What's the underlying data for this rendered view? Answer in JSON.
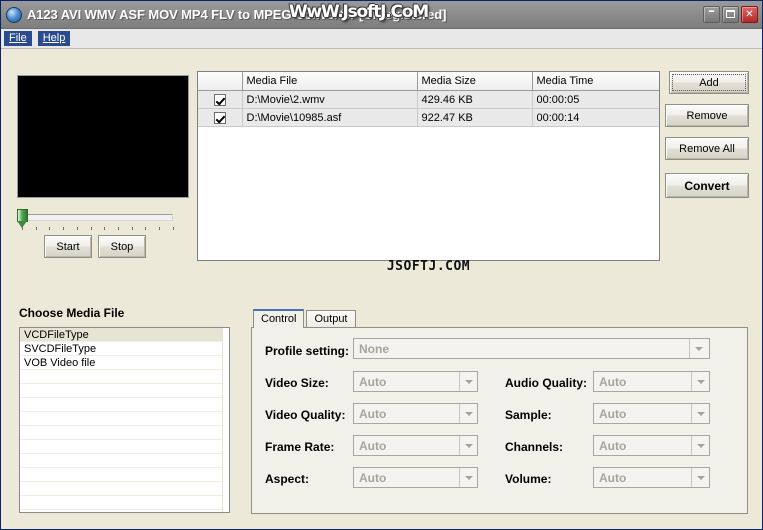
{
  "window": {
    "title": "A123 AVI WMV ASF MOV MP4 FLV to MPEG Converter [Unregistered]",
    "watermark": "WwW.JsoftJ.CoM",
    "minimize_label": "–",
    "maximize_label": "",
    "close_label": "✕"
  },
  "menu": {
    "items": [
      {
        "label": "File"
      },
      {
        "label": "Help"
      }
    ]
  },
  "preview": {
    "slider_value": "0",
    "start_label": "Start",
    "stop_label": "Stop"
  },
  "filelist": {
    "columns": [
      "",
      "Media File",
      "Media Size",
      "Media Time"
    ],
    "rows": [
      {
        "checked": true,
        "file": "D:\\Movie\\2.wmv",
        "size": "429.46 KB",
        "time": "00:00:05"
      },
      {
        "checked": true,
        "file": "D:\\Movie\\10985.asf",
        "size": "922.47 KB",
        "time": "00:00:14"
      }
    ],
    "watermark": "JSOFTJ.COM"
  },
  "actions": {
    "add_label": "Add",
    "remove_label": "Remove",
    "remove_all_label": "Remove All",
    "convert_label": "Convert"
  },
  "media_types": {
    "title": "Choose Media File",
    "items": [
      {
        "label": "VCDFileType",
        "selected": true
      },
      {
        "label": "SVCDFileType",
        "selected": false
      },
      {
        "label": "VOB Video file",
        "selected": false
      }
    ]
  },
  "tabs": [
    {
      "label": "Control",
      "active": true
    },
    {
      "label": "Output",
      "active": false
    }
  ],
  "control_panel": {
    "profile": {
      "label": "Profile setting:",
      "value": "None"
    },
    "left_fields": [
      {
        "label": "Video Size:",
        "value": "Auto"
      },
      {
        "label": "Video Quality:",
        "value": "Auto"
      },
      {
        "label": "Frame Rate:",
        "value": "Auto"
      },
      {
        "label": "Aspect:",
        "value": "Auto"
      }
    ],
    "right_fields": [
      {
        "label": "Audio Quality:",
        "value": "Auto"
      },
      {
        "label": "Sample:",
        "value": "Auto"
      },
      {
        "label": "Channels:",
        "value": "Auto"
      },
      {
        "label": "Volume:",
        "value": "Auto"
      }
    ]
  },
  "colors": {
    "titlebar": "#8a8a8a",
    "menu_highlight": "#2b4b8f",
    "panel": "#ece9d8",
    "slider_thumb": "#4fa84f",
    "list_selection": "#e8e4d4"
  }
}
